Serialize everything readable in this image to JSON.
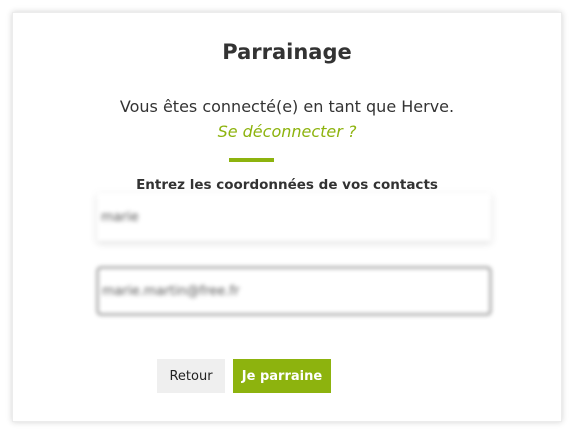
{
  "page": {
    "title": "Parrainage",
    "connected_text": "Vous êtes connecté(e) en tant que Herve.",
    "logout_link": "Se déconnecter ?",
    "instructions": "Entrez les coordonnées de vos contacts"
  },
  "form": {
    "field_1_value": "marie",
    "field_2_value": "marie.martin@free.fr"
  },
  "buttons": {
    "back_label": "Retour",
    "submit_label": "Je parraine"
  },
  "colors": {
    "accent": "#8db30e",
    "text": "#333333",
    "back_button_bg": "#efefef"
  }
}
